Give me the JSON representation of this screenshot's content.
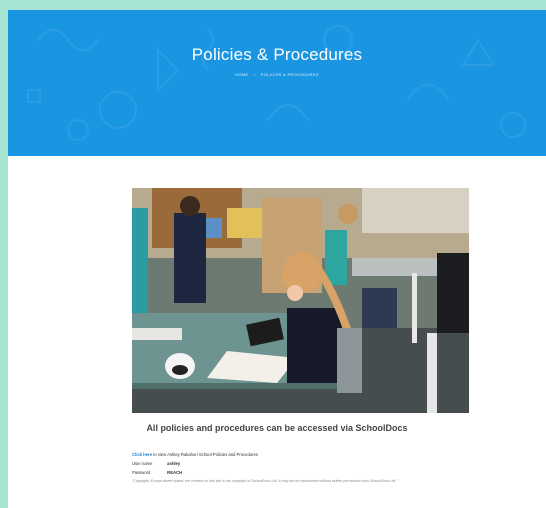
{
  "hero": {
    "title": "Policies & Procedures",
    "breadcrumb": [
      "Home",
      "Policies & Procedures"
    ],
    "background_color": "#1a95e2"
  },
  "main": {
    "photo_alt": "School classroom with students using a tablet",
    "headline": "All policies and procedures can be accessed via SchoolDocs",
    "link_text": "Click here",
    "link_suffix": "to view Ashley Rakahuri School Policies and Procedures",
    "credentials": [
      {
        "label": "User name",
        "value": "ashley"
      },
      {
        "label": "Password",
        "value": "REACH"
      }
    ],
    "copyright_note": "\"Copyright: Except where stated, the content on this site is the copyright of SchoolDocs Ltd. It may not be reproduced without written permission from SchoolDocs Ltd.\"",
    "link_color": "#1a7fd0"
  },
  "frame": {
    "background_color": "#a8e4d4"
  }
}
